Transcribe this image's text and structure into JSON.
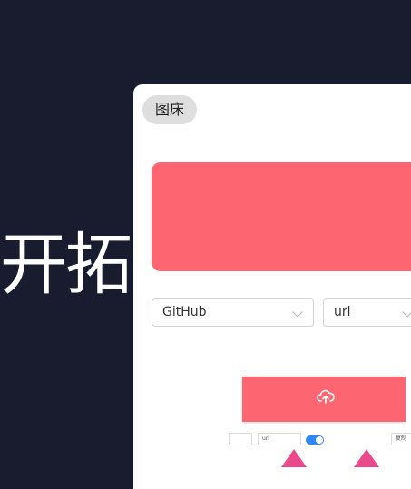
{
  "hero": {
    "text": "开拓"
  },
  "window": {
    "tag_label": "图床",
    "host_select": {
      "value": "GitHub"
    },
    "format_select": {
      "value": "url"
    },
    "preview": {
      "mini_select_a": "",
      "mini_select_b": "url",
      "mini_select_c": "复制"
    }
  },
  "colors": {
    "background": "#181c2e",
    "accent": "#fd6571",
    "arrow": "#ea4a8a",
    "toggle": "#2f86f6"
  }
}
